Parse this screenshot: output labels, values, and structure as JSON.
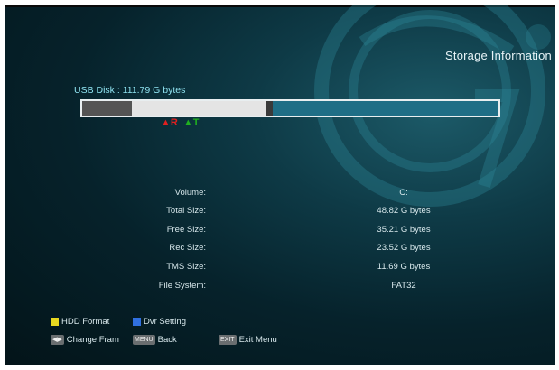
{
  "header": {
    "title": "Storage Information"
  },
  "disk": {
    "label": "USB Disk : 111.79 G bytes",
    "rec_fraction": 0.12,
    "tms_fraction": 0.32
  },
  "markers": {
    "rec": "▲R",
    "tms": "▲T"
  },
  "info": [
    {
      "label": "Volume:",
      "value": "C:"
    },
    {
      "label": "Total Size:",
      "value": "48.82 G bytes"
    },
    {
      "label": "Free Size:",
      "value": "35.21 G bytes"
    },
    {
      "label": "Rec Size:",
      "value": "23.52 G bytes"
    },
    {
      "label": "TMS Size:",
      "value": "11.69 G bytes"
    },
    {
      "label": "File System:",
      "value": "FAT32"
    }
  ],
  "footer": {
    "hdd_format": "HDD Format",
    "dvr_setting": "Dvr Setting",
    "change_frame": "Change Fram",
    "menu_key": "MENU",
    "back": "Back",
    "exit_key": "EXIT",
    "exit_menu": "Exit Menu"
  },
  "colors": {
    "yellow_key": "#e8d820",
    "blue_key": "#3070e0",
    "bar_free": "#1f6e86",
    "bar_tms": "#e4e4e4",
    "bar_rec": "#545454"
  },
  "icons": {
    "nav_arrows": "left-right-arrows-icon",
    "logo": "gi-logo-watermark"
  }
}
